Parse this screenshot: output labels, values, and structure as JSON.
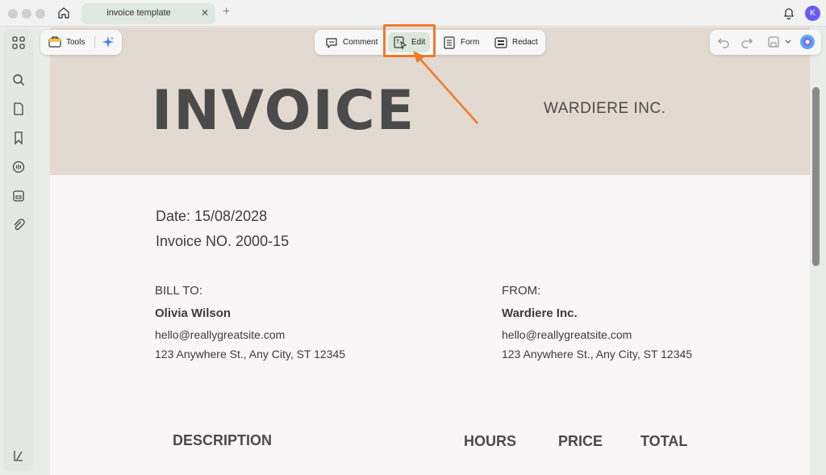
{
  "window": {
    "tab_title": "invoice template",
    "tab_close": "✕",
    "new_tab": "+",
    "avatar_initial": "K"
  },
  "toolbar": {
    "tools_label": "Tools",
    "modes": [
      {
        "label": "Comment",
        "icon": "comment-icon"
      },
      {
        "label": "Edit",
        "icon": "edit-text-icon",
        "active": true
      },
      {
        "label": "Form",
        "icon": "form-icon"
      },
      {
        "label": "Redact",
        "icon": "redact-icon"
      }
    ]
  },
  "document": {
    "title": "INVOICE",
    "company": "WARDIERE INC.",
    "date": "Date: 15/08/2028",
    "invoice_no": "Invoice NO. 2000-15",
    "bill_to": {
      "label": "BILL TO:",
      "name": "Olivia  Wilson",
      "email": "hello@reallygreatsite.com",
      "address": "123 Anywhere St., Any City, ST 12345"
    },
    "from": {
      "label": "FROM:",
      "name": "Wardiere Inc.",
      "email": "hello@reallygreatsite.com",
      "address": "123 Anywhere St., Any City, ST 12345"
    },
    "table_headers": {
      "description": "DESCRIPTION",
      "hours": "HOURS",
      "price": "PRICE",
      "total": "TOTAL"
    }
  },
  "colors": {
    "accent_highlight": "#f07a2b",
    "header_band": "#e2d9d0",
    "active_mode": "#dbe6dc"
  }
}
